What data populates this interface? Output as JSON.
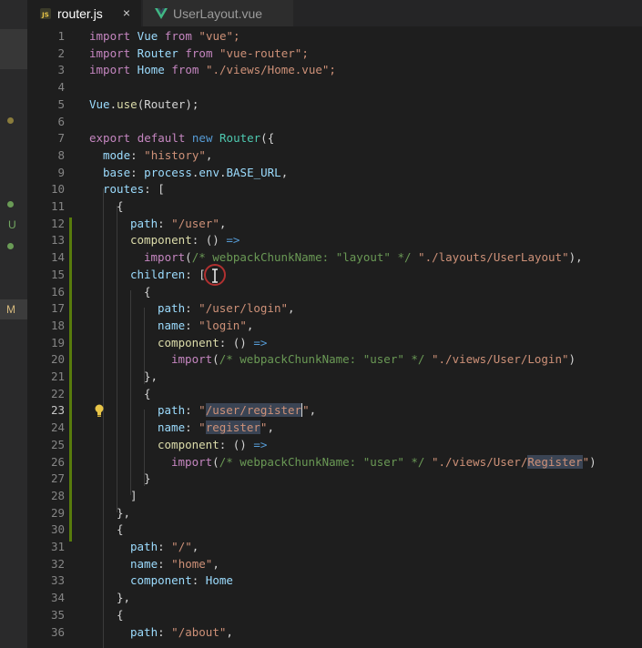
{
  "tabs": [
    {
      "label": "router.js",
      "close": "×",
      "icon": "js-file-icon",
      "color": "#e8c547"
    },
    {
      "label": "UserLayout.vue",
      "icon": "vue-file-icon",
      "color": "#41b883"
    }
  ],
  "activity": {
    "u_label": "U",
    "m_label": "M",
    "dot_color": "#8a7c3c",
    "git_color": "#6a9b56"
  },
  "current_line": 23,
  "lines": [
    {
      "n": "1"
    },
    {
      "n": "2"
    },
    {
      "n": "3"
    },
    {
      "n": "4"
    },
    {
      "n": "5"
    },
    {
      "n": "6"
    },
    {
      "n": "7"
    },
    {
      "n": "8"
    },
    {
      "n": "9"
    },
    {
      "n": "10"
    },
    {
      "n": "11"
    },
    {
      "n": "12"
    },
    {
      "n": "13"
    },
    {
      "n": "14"
    },
    {
      "n": "15"
    },
    {
      "n": "16"
    },
    {
      "n": "17"
    },
    {
      "n": "18"
    },
    {
      "n": "19"
    },
    {
      "n": "20"
    },
    {
      "n": "21"
    },
    {
      "n": "22"
    },
    {
      "n": "23"
    },
    {
      "n": "24"
    },
    {
      "n": "25"
    },
    {
      "n": "26"
    },
    {
      "n": "27"
    },
    {
      "n": "28"
    },
    {
      "n": "29"
    },
    {
      "n": "30"
    },
    {
      "n": "31"
    },
    {
      "n": "32"
    },
    {
      "n": "33"
    },
    {
      "n": "34"
    },
    {
      "n": "35"
    },
    {
      "n": "36"
    }
  ],
  "code": {
    "l1": [
      "import",
      " Vue ",
      "from",
      " \"vue\";"
    ],
    "l2": [
      "import",
      " Router ",
      "from",
      " \"vue-router\";"
    ],
    "l3": [
      "import",
      " Home ",
      "from",
      " \"./views/Home.vue\";"
    ],
    "l5": [
      "Vue",
      ".",
      "use",
      "(Router);"
    ],
    "l7": [
      "export",
      " ",
      "default",
      " ",
      "new",
      " ",
      "Router",
      "({"
    ],
    "l8": [
      "mode",
      ": ",
      "\"history\"",
      ","
    ],
    "l9": [
      "base",
      ": ",
      "process",
      ".",
      "env",
      ".",
      "BASE_URL",
      ","
    ],
    "l10": [
      "routes",
      ": ["
    ],
    "l11": "{",
    "l12": [
      "path",
      ": ",
      "\"/user\"",
      ","
    ],
    "l13": [
      "component",
      ": () ",
      "=>"
    ],
    "l14": [
      "import",
      "(",
      "/* webpackChunkName: \"layout\" */",
      " ",
      "\"./layouts/UserLayout\"",
      "),"
    ],
    "l15": [
      "children",
      ": ["
    ],
    "l16": "{",
    "l17": [
      "path",
      ": ",
      "\"/user/login\"",
      ","
    ],
    "l18": [
      "name",
      ": ",
      "\"login\"",
      ","
    ],
    "l19": [
      "component",
      ": () ",
      "=>"
    ],
    "l20": [
      "import",
      "(",
      "/* webpackChunkName: \"user\" */",
      " ",
      "\"./views/User/Login\"",
      ")"
    ],
    "l21": "},",
    "l22": "{",
    "l23": [
      "path",
      ": ",
      "\"",
      "/user/register",
      "\"",
      ","
    ],
    "l24": [
      "name",
      ": ",
      "\"",
      "register",
      "\"",
      ","
    ],
    "l25": [
      "component",
      ": () ",
      "=>"
    ],
    "l26": [
      "import",
      "(",
      "/* webpackChunkName: \"user\" */",
      " ",
      "\"./views/User/",
      "Register",
      "\"",
      ")"
    ],
    "l27": "}",
    "l28": "]",
    "l29": "},",
    "l30": "{",
    "l31": [
      "path",
      ": ",
      "\"/\"",
      ","
    ],
    "l32": [
      "name",
      ": ",
      "\"home\"",
      ","
    ],
    "l33": [
      "component",
      ": ",
      "Home"
    ],
    "l34": "},",
    "l35": "{",
    "l36": [
      "path",
      ": ",
      "\"/about\"",
      ","
    ]
  }
}
